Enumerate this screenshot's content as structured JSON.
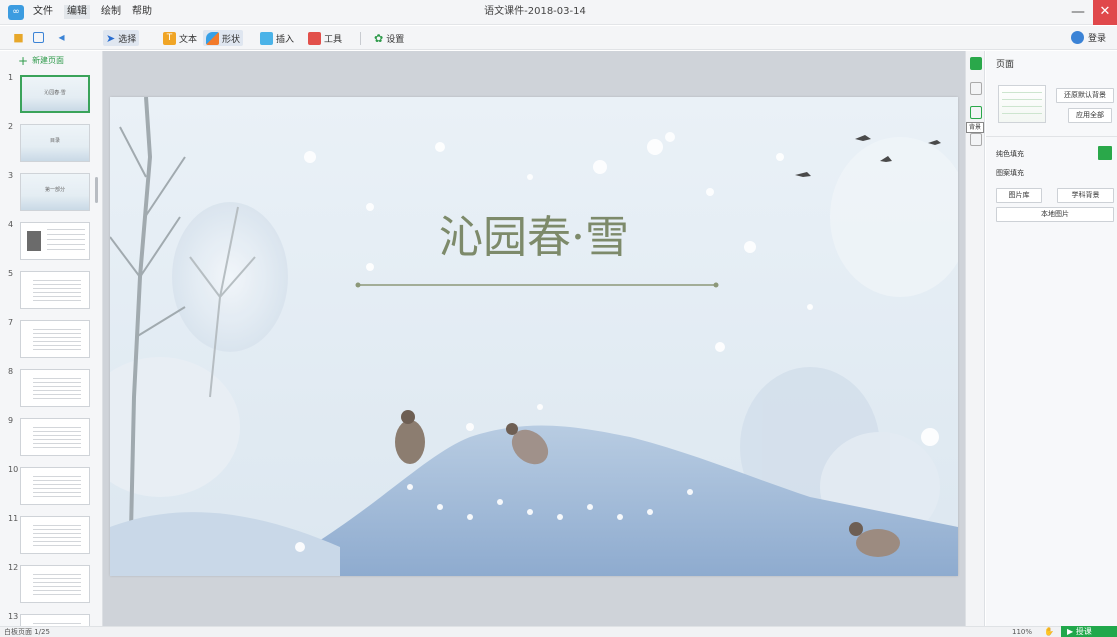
{
  "titlebar": {
    "logo_glyph": "∞",
    "menus": [
      "文件",
      "编辑",
      "绘制",
      "帮助"
    ],
    "title": "语文课件-2018-03-14",
    "minimize": "—",
    "close": "✕"
  },
  "toolbar": {
    "select_label": "选择",
    "text_label": "文本",
    "shape_label": "形状",
    "insert_label": "插入",
    "tools_label": "工具",
    "settings_label": "设置",
    "login_label": "登录"
  },
  "left_panel": {
    "new_page_label": "新建页面",
    "pages": [
      {
        "num": "1",
        "title": "沁园春·雪",
        "kind": "snow"
      },
      {
        "num": "2",
        "title": "目录",
        "kind": "snow"
      },
      {
        "num": "3",
        "title": "第一部分",
        "kind": "snow"
      },
      {
        "num": "4",
        "title": "",
        "kind": "portrait"
      },
      {
        "num": "5",
        "title": "",
        "kind": "text"
      },
      {
        "num": "7",
        "title": "",
        "kind": "text"
      },
      {
        "num": "8",
        "title": "",
        "kind": "text"
      },
      {
        "num": "9",
        "title": "",
        "kind": "text"
      },
      {
        "num": "10",
        "title": "",
        "kind": "text"
      },
      {
        "num": "11",
        "title": "",
        "kind": "text"
      },
      {
        "num": "12",
        "title": "",
        "kind": "text"
      },
      {
        "num": "13",
        "title": "",
        "kind": "text"
      }
    ]
  },
  "slide": {
    "title": "沁园春·雪",
    "colors": {
      "title": "#7d8a6a",
      "bg": "#e8eff6",
      "hill": "#a9bfda"
    }
  },
  "right_strip": {
    "tooltip": "背景"
  },
  "properties": {
    "title": "页面",
    "restore_default_bg": "还原默认背景",
    "apply_all": "应用全部",
    "solid_fill_label": "纯色填充",
    "pattern_fill_label": "图案填充",
    "gallery_button": "图片库",
    "subject_bg_button": "学科背景",
    "local_image_button": "本地图片",
    "fill_color": "#2aa84a"
  },
  "statusbar": {
    "page_status": "白板页面 1/25",
    "zoom": "110%",
    "teach_button": "▶ 授课"
  }
}
